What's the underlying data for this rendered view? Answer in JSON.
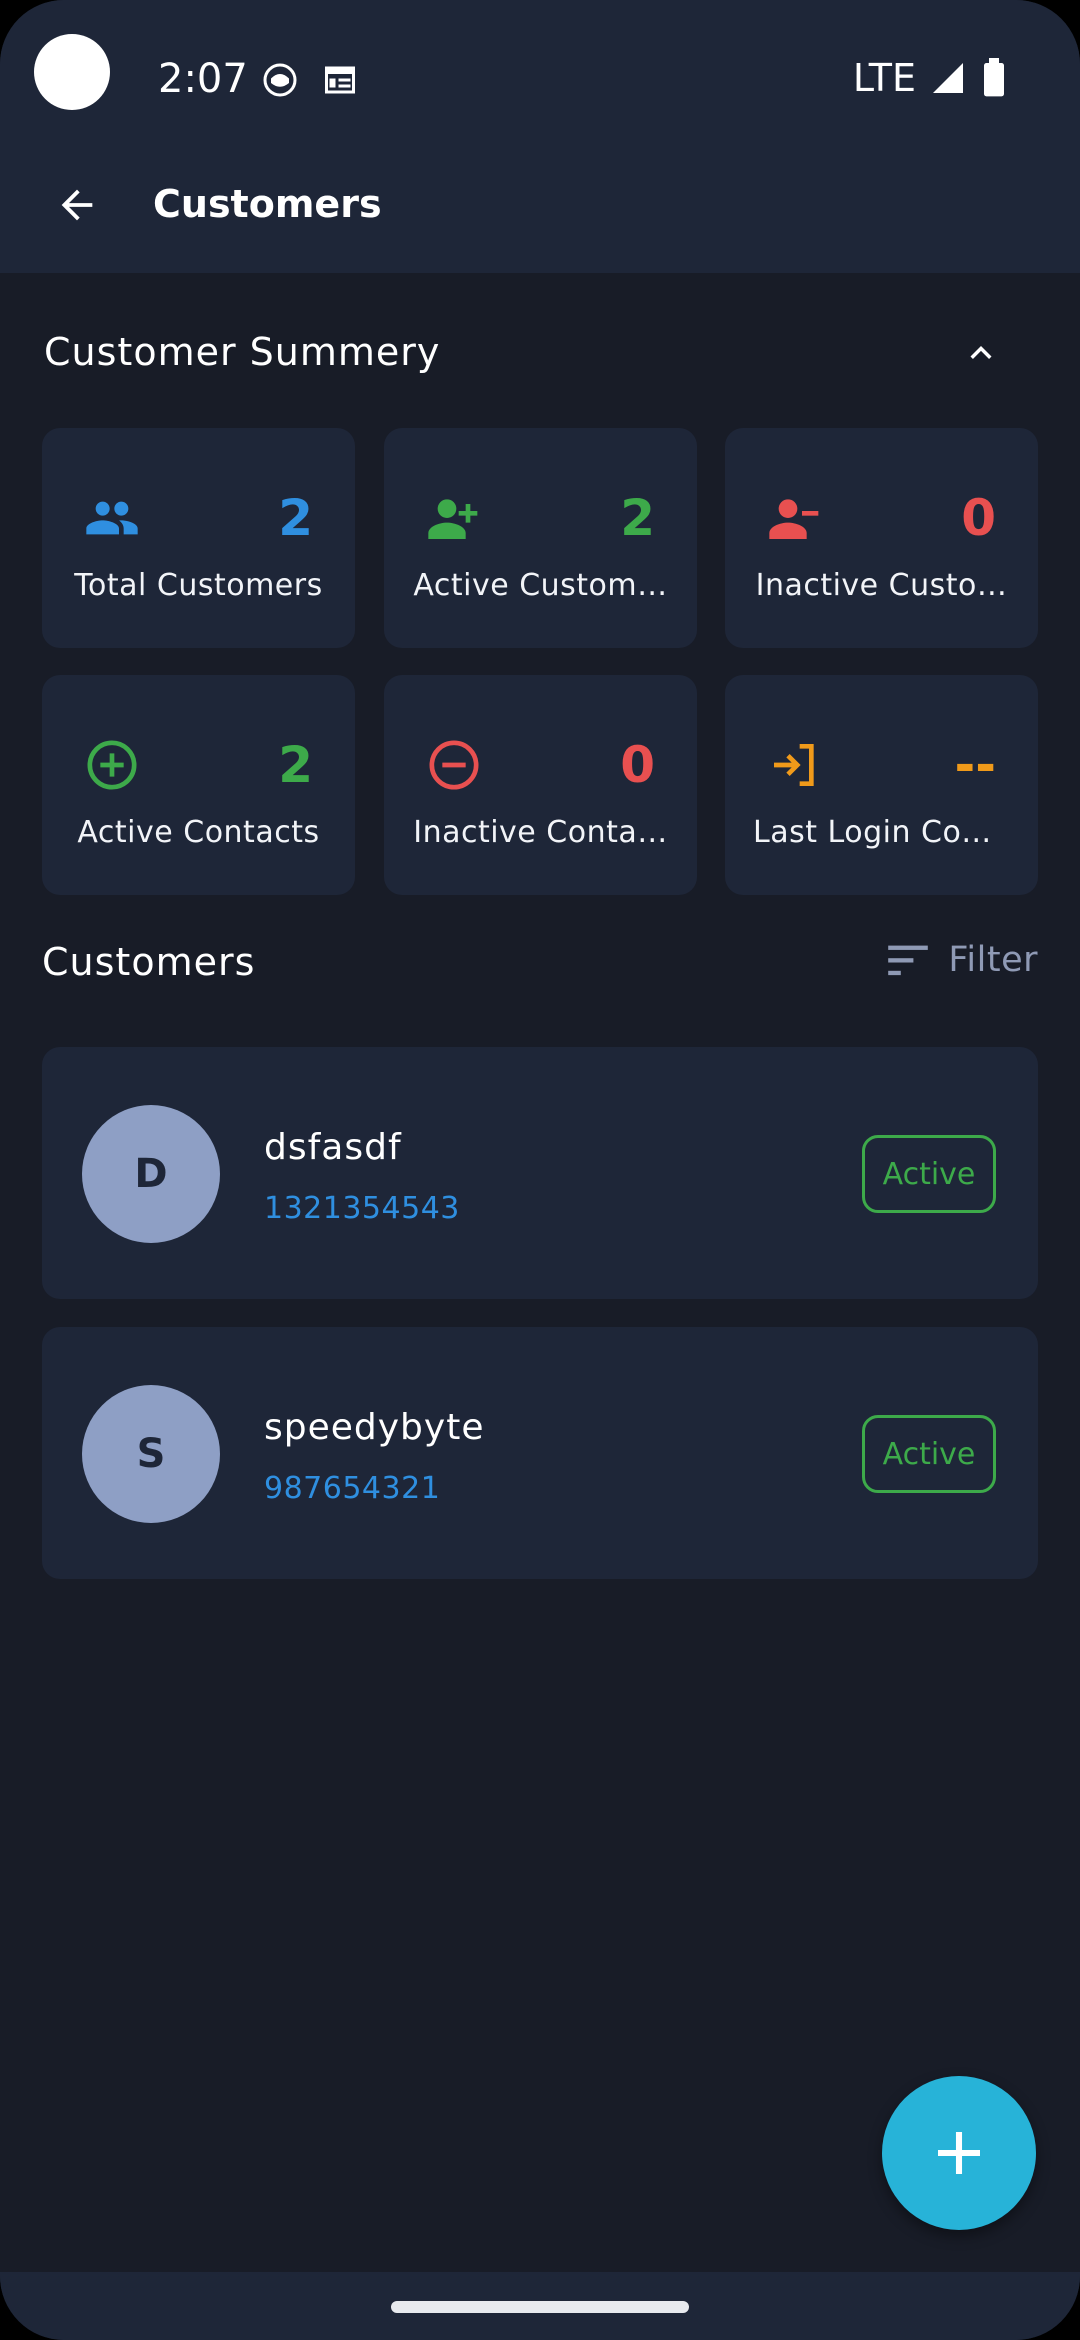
{
  "status_bar": {
    "time": "2:07",
    "network": "LTE"
  },
  "app_bar": {
    "title": "Customers"
  },
  "summary": {
    "title": "Customer Summery",
    "cards": [
      {
        "label": "Total Customers",
        "value": "2",
        "color": "#2f8fe0",
        "icon": "people-icon"
      },
      {
        "label": "Active Custom…",
        "value": "2",
        "color": "#3daa4a",
        "icon": "person-add-icon"
      },
      {
        "label": "Inactive Custo…",
        "value": "0",
        "color": "#e85050",
        "icon": "person-remove-icon"
      },
      {
        "label": "Active Contacts",
        "value": "2",
        "color": "#3daa4a",
        "icon": "circle-plus-icon"
      },
      {
        "label": "Inactive Conta…",
        "value": "0",
        "color": "#e85050",
        "icon": "circle-minus-icon"
      },
      {
        "label": "Last Login Con…",
        "value": "--",
        "color": "#f09a1a",
        "icon": "login-icon"
      }
    ]
  },
  "customers_section": {
    "title": "Customers",
    "filter_label": "Filter",
    "items": [
      {
        "initial": "D",
        "name": "dsfasdf",
        "phone": "1321354543",
        "status": "Active"
      },
      {
        "initial": "S",
        "name": "speedybyte",
        "phone": "987654321",
        "status": "Active"
      }
    ]
  },
  "colors": {
    "background": "#181c27",
    "surface": "#1e2638",
    "accent": "#27b3d8",
    "active": "#3daa4a"
  }
}
